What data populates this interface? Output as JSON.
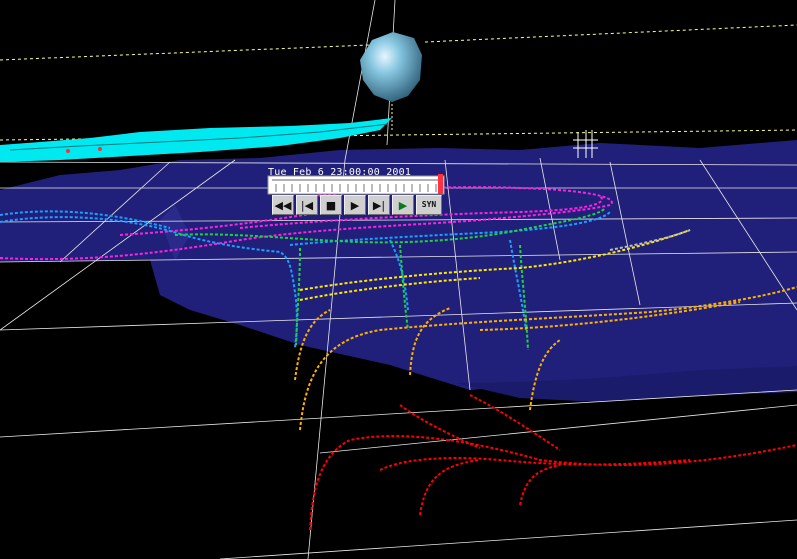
{
  "scene": {
    "timestamp": "Tue Feb  6 23:00:00 2001",
    "colors": {
      "background": "#000000",
      "grid": "#ffffff",
      "terrain": "#20207a",
      "plume": "#00e8f0",
      "sphere": "#7fb6cf",
      "trajectories": [
        "#ff0000",
        "#ffb000",
        "#ffe800",
        "#19d63b",
        "#1aa0ff",
        "#ff20e0",
        "#bdbdbd"
      ]
    }
  },
  "vcr": {
    "buttons": [
      {
        "id": "rewind",
        "symbol": "◀◀",
        "icon": "fast-rewind-icon"
      },
      {
        "id": "step-back",
        "symbol": "|◀",
        "icon": "step-back-icon"
      },
      {
        "id": "stop",
        "symbol": "■",
        "icon": "stop-icon"
      },
      {
        "id": "play",
        "symbol": "▶",
        "icon": "play-icon"
      },
      {
        "id": "step-forward",
        "symbol": "▶|",
        "icon": "step-forward-icon"
      },
      {
        "id": "forward",
        "symbol": "▶",
        "icon": "animate-forward-icon"
      },
      {
        "id": "sync",
        "symbol": "SYN",
        "icon": "sync-icon"
      }
    ]
  }
}
